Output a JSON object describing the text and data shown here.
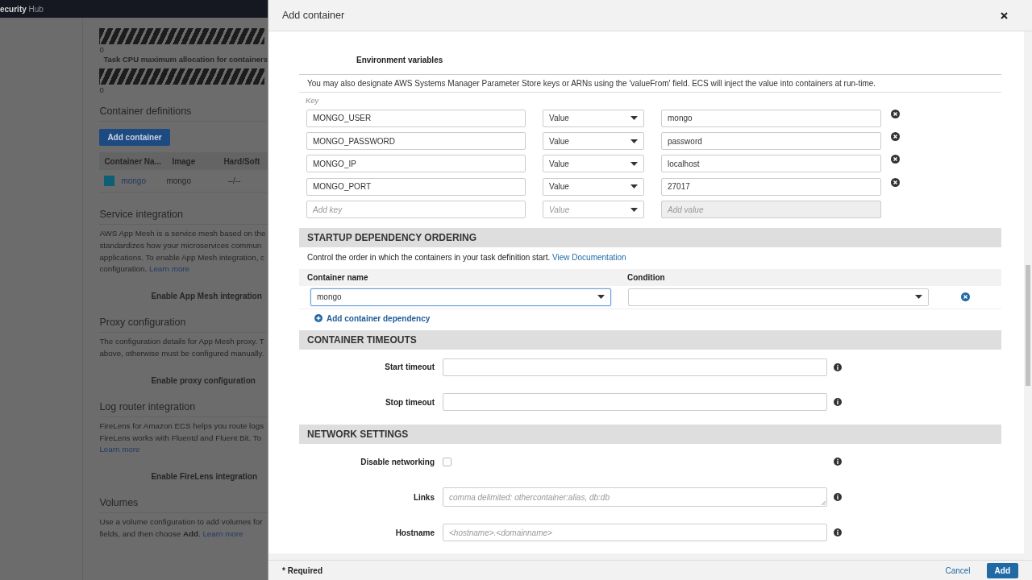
{
  "background": {
    "brand": "**ecurity** Hub",
    "meter_values": [
      "0",
      "0"
    ],
    "cpu_label": "Task CPU maximum allocation for containers",
    "definitions": {
      "title": "Container definitions",
      "button": "Add container",
      "columns": [
        "Container Na...",
        "Image",
        "Hard/Soft"
      ],
      "rows": [
        {
          "color": "#0e5f73",
          "cells": [
            "mongo",
            "mongo",
            "--/--"
          ]
        }
      ]
    },
    "sections": [
      {
        "title": "Service integration",
        "text": "AWS App Mesh is a service mesh based on the\nstandardizes how your microservices commun\napplications. To enable App Mesh integration, c\nconfiguration. ",
        "link": "Learn more",
        "button": "Enable App Mesh integration"
      },
      {
        "title": "Proxy configuration",
        "text": "The configuration details for App Mesh proxy. T\nabove, otherwise must be configured manually.",
        "button": "Enable proxy configuration"
      },
      {
        "title": "Log router integration",
        "text": "FireLens for Amazon ECS helps you route logs\nFireLens works with Fluentd and Fluent Bit. To\n",
        "link": "Learn more",
        "button": "Enable FireLens integration"
      },
      {
        "title": "Volumes",
        "text": "Use a volume configuration to add volumes for\nfields, and then choose **Add**. ",
        "link": "Learn more"
      }
    ]
  },
  "modal": {
    "title": "Add container",
    "env": {
      "title": "Environment variables",
      "note": "You may also designate AWS Systems Manager Parameter Store keys or ARNs using the 'valueFrom' field. ECS will inject the value into containers at run-time.",
      "key_header": "Key",
      "rows": [
        {
          "key": "MONGO_USER",
          "type": "Value",
          "value": "mongo"
        },
        {
          "key": "MONGO_PASSWORD",
          "type": "Value",
          "value": "password"
        },
        {
          "key": "MONGO_IP",
          "type": "Value",
          "value": "localhost"
        },
        {
          "key": "MONGO_PORT",
          "type": "Value",
          "value": "27017"
        }
      ],
      "new_row": {
        "key_placeholder": "Add key",
        "type": "Value",
        "value_placeholder": "Add value"
      }
    },
    "startup": {
      "title": "STARTUP DEPENDENCY ORDERING",
      "note": "Control the order in which the containers in your task definition start. ",
      "link": "View Documentation",
      "columns": [
        "Container name",
        "Condition"
      ],
      "rows": [
        {
          "container": "mongo"
        }
      ],
      "add_link": "Add container dependency"
    },
    "timeouts": {
      "title": "CONTAINER TIMEOUTS",
      "fields": [
        {
          "label": "Start timeout"
        },
        {
          "label": "Stop timeout"
        }
      ]
    },
    "network": {
      "title": "NETWORK SETTINGS",
      "fields": [
        {
          "kind": "checkbox",
          "label": "Disable networking",
          "checked": false
        },
        {
          "kind": "textarea",
          "label": "Links",
          "placeholder": "comma delimited: othercontainer:alias, db:db"
        },
        {
          "kind": "input",
          "label": "Hostname",
          "placeholder": "<hostname>.<domainname>"
        }
      ]
    },
    "footer": {
      "required": "* Required",
      "cancel": "Cancel",
      "add": "Add"
    }
  }
}
